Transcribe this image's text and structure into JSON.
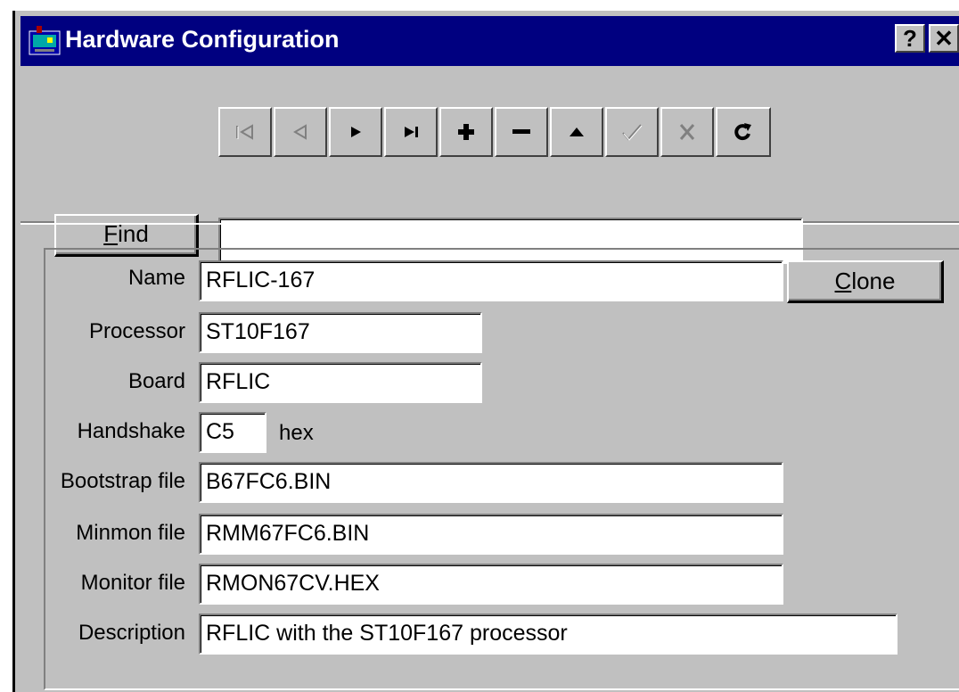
{
  "window": {
    "title": "Hardware Configuration",
    "help_label": "?",
    "close_label": "✕",
    "colors": {
      "titlebar": "#000080",
      "face": "#c0c0c0"
    }
  },
  "navigator": {
    "buttons": [
      {
        "name": "first-record",
        "icon": "first-icon",
        "enabled": false
      },
      {
        "name": "prior-record",
        "icon": "prior-icon",
        "enabled": false
      },
      {
        "name": "next-record",
        "icon": "next-icon",
        "enabled": true
      },
      {
        "name": "last-record",
        "icon": "last-icon",
        "enabled": true
      },
      {
        "name": "insert-record",
        "icon": "plus-icon",
        "enabled": true
      },
      {
        "name": "delete-record",
        "icon": "minus-icon",
        "enabled": true
      },
      {
        "name": "edit-record",
        "icon": "up-arrow-icon",
        "enabled": true
      },
      {
        "name": "post-record",
        "icon": "checkmark-icon",
        "enabled": false
      },
      {
        "name": "cancel-record",
        "icon": "cancel-x-icon",
        "enabled": false
      },
      {
        "name": "refresh-record",
        "icon": "refresh-icon",
        "enabled": true
      }
    ]
  },
  "find": {
    "mnemonic": "F",
    "rest": "ind",
    "value": ""
  },
  "clone": {
    "mnemonic": "C",
    "rest": "lone"
  },
  "form": {
    "name_label": "Name",
    "name_value": "RFLIC-167",
    "processor_label": "Processor",
    "processor_value": "ST10F167",
    "board_label": "Board",
    "board_value": "RFLIC",
    "handshake_label": "Handshake",
    "handshake_value": "C5",
    "handshake_unit": "hex",
    "bootstrap_label": "Bootstrap file",
    "bootstrap_value": "B67FC6.BIN",
    "minmon_label": "Minmon file",
    "minmon_value": "RMM67FC6.BIN",
    "monitor_label": "Monitor file",
    "monitor_value": "RMON67CV.HEX",
    "description_label": "Description",
    "description_value": "RFLIC with the ST10F167 processor"
  }
}
